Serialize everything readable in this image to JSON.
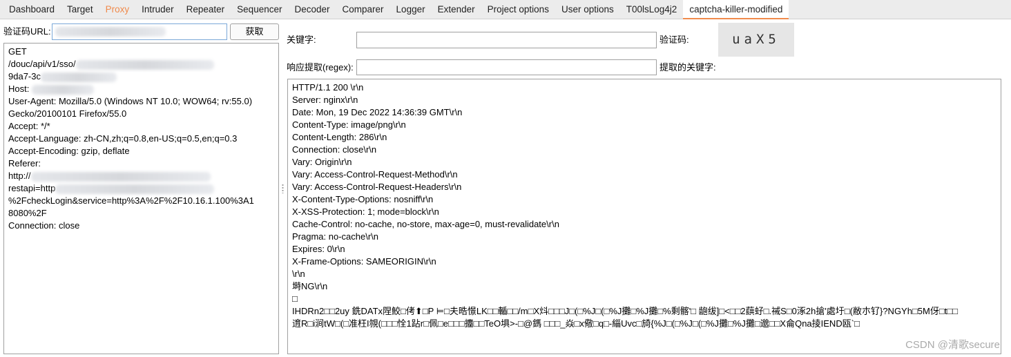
{
  "tabs": [
    {
      "label": "Dashboard"
    },
    {
      "label": "Target"
    },
    {
      "label": "Proxy",
      "highlight": true
    },
    {
      "label": "Intruder"
    },
    {
      "label": "Repeater"
    },
    {
      "label": "Sequencer"
    },
    {
      "label": "Decoder"
    },
    {
      "label": "Comparer"
    },
    {
      "label": "Logger"
    },
    {
      "label": "Extender"
    },
    {
      "label": "Project options"
    },
    {
      "label": "User options"
    },
    {
      "label": "T00lsLog4j2"
    },
    {
      "label": "captcha-killer-modified",
      "selected": true
    }
  ],
  "accent_color": "#f08a4b",
  "left": {
    "url_label": "验证码URL:",
    "fetch_button": "获取",
    "request_lines": [
      "GET",
      "/douc/api/v1/sso/",
      "9da7-3c",
      "Host: ",
      "User-Agent: Mozilla/5.0 (Windows NT 10.0; WOW64; rv:55.0)",
      "Gecko/20100101 Firefox/55.0",
      "Accept: */*",
      "Accept-Language: zh-CN,zh;q=0.8,en-US;q=0.5,en;q=0.3",
      "Accept-Encoding: gzip, deflate",
      "Referer:",
      "http://",
      "restapi=http",
      "%2FcheckLogin&service=http%3A%2F%2F10.16.1.100%3A1",
      "8080%2F",
      "Connection: close"
    ]
  },
  "right": {
    "keyword_label": "关键字:",
    "captcha_label": "验证码:",
    "captcha_text": "uaX5",
    "regex_label": "响应提取(regex):",
    "extracted_label": "提取的关键字:",
    "response_lines": [
      "HTTP/1.1 200 \\r\\n",
      "Server: nginx\\r\\n",
      "Date: Mon, 19 Dec 2022 14:36:39 GMT\\r\\n",
      "Content-Type: image/png\\r\\n",
      "Content-Length: 286\\r\\n",
      "Connection: close\\r\\n",
      "Vary: Origin\\r\\n",
      "Vary: Access-Control-Request-Method\\r\\n",
      "Vary: Access-Control-Request-Headers\\r\\n",
      "X-Content-Type-Options: nosniff\\r\\n",
      "X-XSS-Protection: 1; mode=block\\r\\n",
      "Cache-Control: no-cache, no-store, max-age=0, must-revalidate\\r\\n",
      "Pragma: no-cache\\r\\n",
      "Expires: 0\\r\\n",
      "X-Frame-Options: SAMEORIGIN\\r\\n",
      "\\r\\n",
      "塒NG\\r\\n",
      "□",
      "IHDRn2□□2uy 銑DATx陧鮫□侤⬆□P ⊨□夫晧憬LK□□輴□□/m□X炓□□□J□(□%J□(□%J攤□%J攤□%剩髂'□ 龅绂]□<□□2蕻虸□.祴S□0涿2h搶'處圩□(敝朩钌}?NGYh□5M伢□t□□",
      "逳R□i涧tW□(□准枉I覙(□□□恮1跕r□佩□e□□□攟□□TeO埧>-□@鎷 □□□_焱□x儆□q□-緇Uvc□旑{%J□(□%J□(□%J攤□%J攤□邈□□X侖Qna掕IEND瓯`□"
    ]
  },
  "watermark": "CSDN @清歌secure"
}
